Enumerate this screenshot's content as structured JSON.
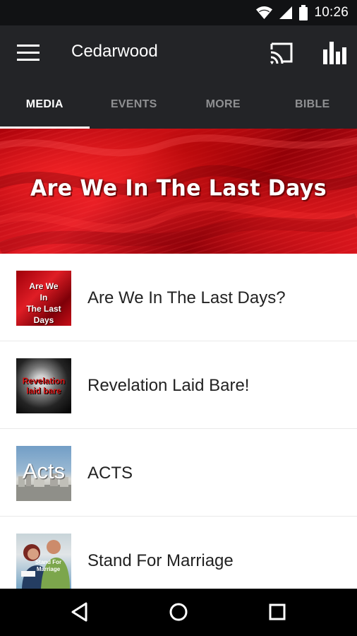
{
  "status_bar": {
    "time": "10:26",
    "icons": [
      "wifi-icon",
      "signal-icon",
      "battery-icon"
    ]
  },
  "app_bar": {
    "title": "Cedarwood",
    "icons": [
      "menu-icon",
      "cast-icon",
      "chart-icon"
    ]
  },
  "tabs": [
    {
      "label": "MEDIA",
      "active": true
    },
    {
      "label": "EVENTS",
      "active": false
    },
    {
      "label": "MORE",
      "active": false
    },
    {
      "label": "BIBLE",
      "active": false
    }
  ],
  "banner": {
    "title": "Are We In The Last Days"
  },
  "media_items": [
    {
      "title": "Are We In The Last Days?",
      "thumbnail_text": "Are We\nIn\nThe Last Days"
    },
    {
      "title": "Revelation Laid Bare!",
      "thumbnail_text": "Revelation\nlaid bare"
    },
    {
      "title": "ACTS",
      "thumbnail_text": "Acts"
    },
    {
      "title": "Stand For Marriage",
      "thumbnail_text": "Stand For Marriage"
    }
  ],
  "navigation_bar": {
    "icons": [
      "back-icon",
      "home-icon",
      "recent-apps-icon"
    ]
  },
  "colors": {
    "status_bar": "#111214",
    "app_bar": "#232427",
    "active_tab": "#ffffff",
    "inactive_tab": "#8f9092",
    "banner_red": "#d9151d",
    "list_text": "#222222",
    "navigation_bar": "#000000"
  }
}
